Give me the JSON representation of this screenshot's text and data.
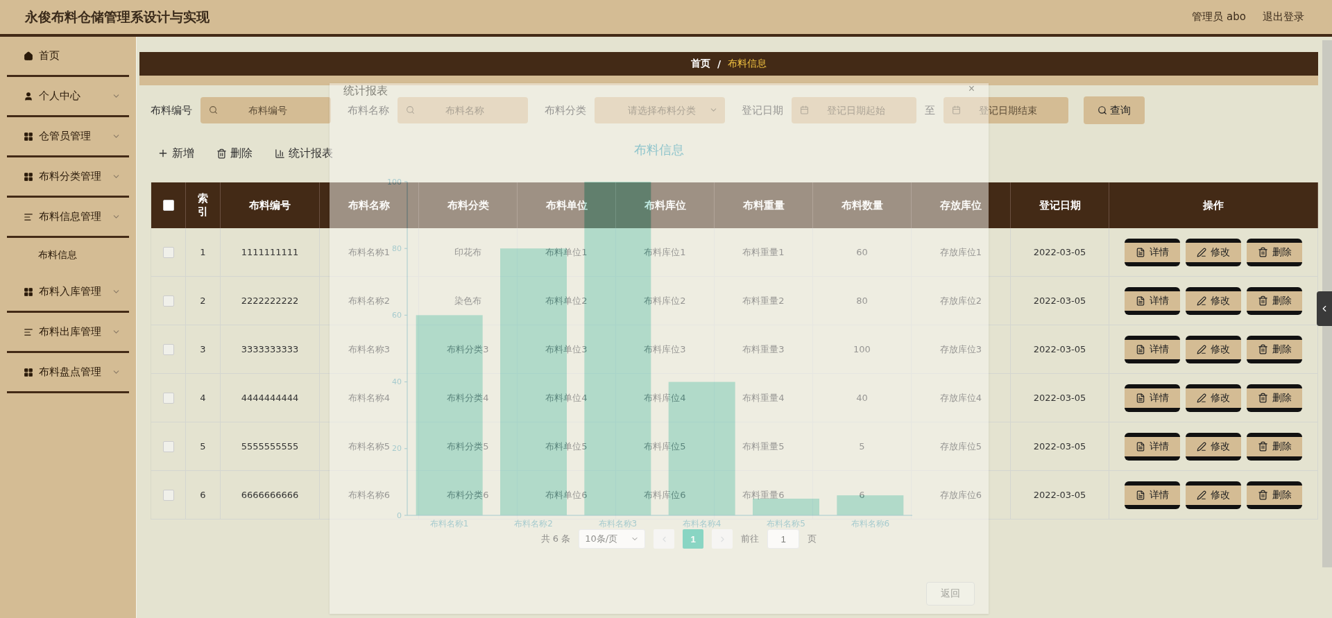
{
  "header": {
    "title": "永俊布料仓储管理系设计与实现",
    "user": "管理员 abo",
    "logout": "退出登录"
  },
  "sidebar": {
    "items": [
      {
        "label": "首页",
        "kind": "home"
      },
      {
        "label": "个人中心",
        "kind": "person",
        "submenu": true
      },
      {
        "label": "仓管员管理",
        "kind": "grid",
        "submenu": true
      },
      {
        "label": "布料分类管理",
        "kind": "grid",
        "submenu": true
      },
      {
        "label": "布料信息管理",
        "kind": "list",
        "submenu": true,
        "children": [
          {
            "label": "布料信息"
          }
        ]
      },
      {
        "label": "布料入库管理",
        "kind": "grid",
        "submenu": true
      },
      {
        "label": "布料出库管理",
        "kind": "list",
        "submenu": true
      },
      {
        "label": "布料盘点管理",
        "kind": "grid",
        "submenu": true
      }
    ]
  },
  "breadcrumb": [
    {
      "label": "首页",
      "selected": false
    },
    {
      "separator": "/"
    },
    {
      "label": "布料信息",
      "selected": true
    }
  ],
  "search": {
    "fields": [
      {
        "label": "布料编号",
        "kind": "text",
        "placeholder": "布料编号"
      },
      {
        "label": "布料名称",
        "kind": "text",
        "placeholder": "布料名称"
      },
      {
        "label": "布料分类",
        "kind": "select",
        "placeholder": "请选择布料分类"
      },
      {
        "label": "登记日期",
        "kind": "date",
        "placeholder": "登记日期起始"
      },
      {
        "label": "至",
        "kind": "date",
        "placeholder": "登记日期结束"
      }
    ],
    "button": "查询"
  },
  "toolbar": [
    {
      "label": "新增",
      "kind": "add"
    },
    {
      "label": "删除",
      "kind": "delete"
    },
    {
      "label": "统计报表",
      "kind": "chart"
    }
  ],
  "table": {
    "header_checked": false,
    "columns": [
      "索引",
      "布料编号",
      "布料名称",
      "布料分类",
      "布料单位",
      "布料库位",
      "布料重量",
      "布料数量",
      "存放库位",
      "登记日期",
      "操作"
    ],
    "rows": [
      {
        "checked": false,
        "cells": [
          "1",
          "1111111111",
          "布料名称1",
          "印花布",
          "布料单位1",
          "布料库位1",
          "布料重量1",
          "60",
          "存放库位1",
          "2022-03-05"
        ],
        "actions": [
          {
            "label": "详情",
            "kind": "details"
          },
          {
            "label": "修改",
            "kind": "edit"
          },
          {
            "label": "删除",
            "kind": "delete"
          }
        ]
      },
      {
        "checked": false,
        "cells": [
          "2",
          "2222222222",
          "布料名称2",
          "染色布",
          "布料单位2",
          "布料库位2",
          "布料重量2",
          "80",
          "存放库位2",
          "2022-03-05"
        ],
        "actions": [
          {
            "label": "详情",
            "kind": "details"
          },
          {
            "label": "修改",
            "kind": "edit"
          },
          {
            "label": "删除",
            "kind": "delete"
          }
        ]
      },
      {
        "checked": false,
        "cells": [
          "3",
          "3333333333",
          "布料名称3",
          "布料分类3",
          "布料单位3",
          "布料库位3",
          "布料重量3",
          "100",
          "存放库位3",
          "2022-03-05"
        ],
        "actions": [
          {
            "label": "详情",
            "kind": "details"
          },
          {
            "label": "修改",
            "kind": "edit"
          },
          {
            "label": "删除",
            "kind": "delete"
          }
        ]
      },
      {
        "checked": false,
        "cells": [
          "4",
          "4444444444",
          "布料名称4",
          "布料分类4",
          "布料单位4",
          "布料库位4",
          "布料重量4",
          "40",
          "存放库位4",
          "2022-03-05"
        ],
        "actions": [
          {
            "label": "详情",
            "kind": "details"
          },
          {
            "label": "修改",
            "kind": "edit"
          },
          {
            "label": "删除",
            "kind": "delete"
          }
        ]
      },
      {
        "checked": false,
        "cells": [
          "5",
          "5555555555",
          "布料名称5",
          "布料分类5",
          "布料单位5",
          "布料库位5",
          "布料重量5",
          "5",
          "存放库位5",
          "2022-03-05"
        ],
        "actions": [
          {
            "label": "详情",
            "kind": "details"
          },
          {
            "label": "修改",
            "kind": "edit"
          },
          {
            "label": "删除",
            "kind": "delete"
          }
        ]
      },
      {
        "checked": false,
        "cells": [
          "6",
          "6666666666",
          "布料名称6",
          "布料分类6",
          "布料单位6",
          "布料库位6",
          "布料重量6",
          "6",
          "存放库位6",
          "2022-03-05"
        ],
        "actions": [
          {
            "label": "详情",
            "kind": "details"
          },
          {
            "label": "修改",
            "kind": "edit"
          },
          {
            "label": "删除",
            "kind": "delete"
          }
        ]
      }
    ]
  },
  "pagination": {
    "total": "共 6 条",
    "page_size": "10条/页",
    "pages": [
      {
        "label": "1",
        "selected": true
      }
    ],
    "goto_label": "前往",
    "goto_value": "1",
    "goto_suffix": "页"
  },
  "dialog": {
    "title": "统计报表",
    "close": "×",
    "back_button": "返回",
    "chart_data": {
      "type": "bar",
      "title": "布料信息",
      "categories": [
        "布料名称1",
        "布料名称2",
        "布料名称3",
        "布料名称4",
        "布料名称5",
        "布料名称6"
      ],
      "series": [
        {
          "color": "#7fd3c3",
          "values": [
            60,
            80,
            100,
            40,
            5,
            6
          ]
        }
      ],
      "ylim": [
        0,
        100
      ],
      "yticks": [
        0,
        20,
        40,
        60,
        80,
        100
      ]
    }
  }
}
